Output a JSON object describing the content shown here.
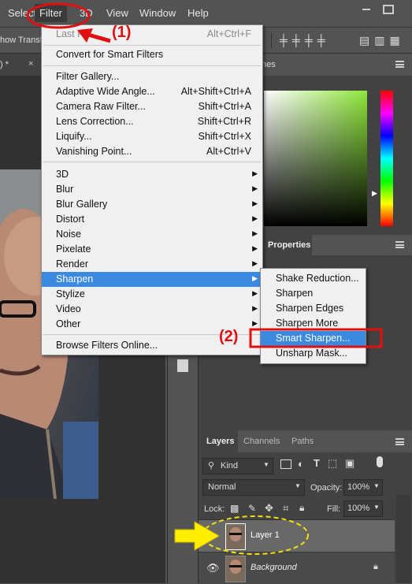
{
  "menubar": {
    "items": [
      "Select",
      "Filter",
      "3D",
      "View",
      "Window",
      "Help"
    ]
  },
  "options_bar": {
    "text": "how Transf"
  },
  "doc_tab": {
    "label": ") *"
  },
  "filter_menu": {
    "last_filter": {
      "label": "Last Fi",
      "shortcut": "Alt+Ctrl+F"
    },
    "convert": "Convert for Smart Filters",
    "items_group1": [
      {
        "label": "Filter Gallery...",
        "shortcut": ""
      },
      {
        "label": "Adaptive Wide Angle...",
        "shortcut": "Alt+Shift+Ctrl+A"
      },
      {
        "label": "Camera Raw Filter...",
        "shortcut": "Shift+Ctrl+A"
      },
      {
        "label": "Lens Correction...",
        "shortcut": "Shift+Ctrl+R"
      },
      {
        "label": "Liquify...",
        "shortcut": "Shift+Ctrl+X"
      },
      {
        "label": "Vanishing Point...",
        "shortcut": "Alt+Ctrl+V"
      }
    ],
    "submenus": [
      "3D",
      "Blur",
      "Blur Gallery",
      "Distort",
      "Noise",
      "Pixelate",
      "Render",
      "Sharpen",
      "Stylize",
      "Video",
      "Other"
    ],
    "browse": "Browse Filters Online..."
  },
  "sharpen_submenu": {
    "items": [
      "Shake Reduction...",
      "Sharpen",
      "Sharpen Edges",
      "Sharpen More",
      "Smart Sharpen...",
      "Unsharp Mask..."
    ]
  },
  "annotations": {
    "step1": "(1)",
    "step2": "(2)"
  },
  "panels": {
    "color_tab_fragment": "nes",
    "properties_tab": "Properties"
  },
  "layers_panel": {
    "tabs": [
      "Layers",
      "Channels",
      "Paths"
    ],
    "kind_label": "Kind",
    "blend_mode": "Normal",
    "opacity_label": "Opacity:",
    "opacity_value": "100%",
    "lock_label": "Lock:",
    "fill_label": "Fill:",
    "fill_value": "100%",
    "layers": [
      {
        "name": "Layer 1"
      },
      {
        "name": "Background"
      }
    ]
  },
  "colors": {
    "highlight": "#3c8ae0",
    "annotation_red": "#e01010",
    "arrow_yellow": "#ffee00"
  }
}
